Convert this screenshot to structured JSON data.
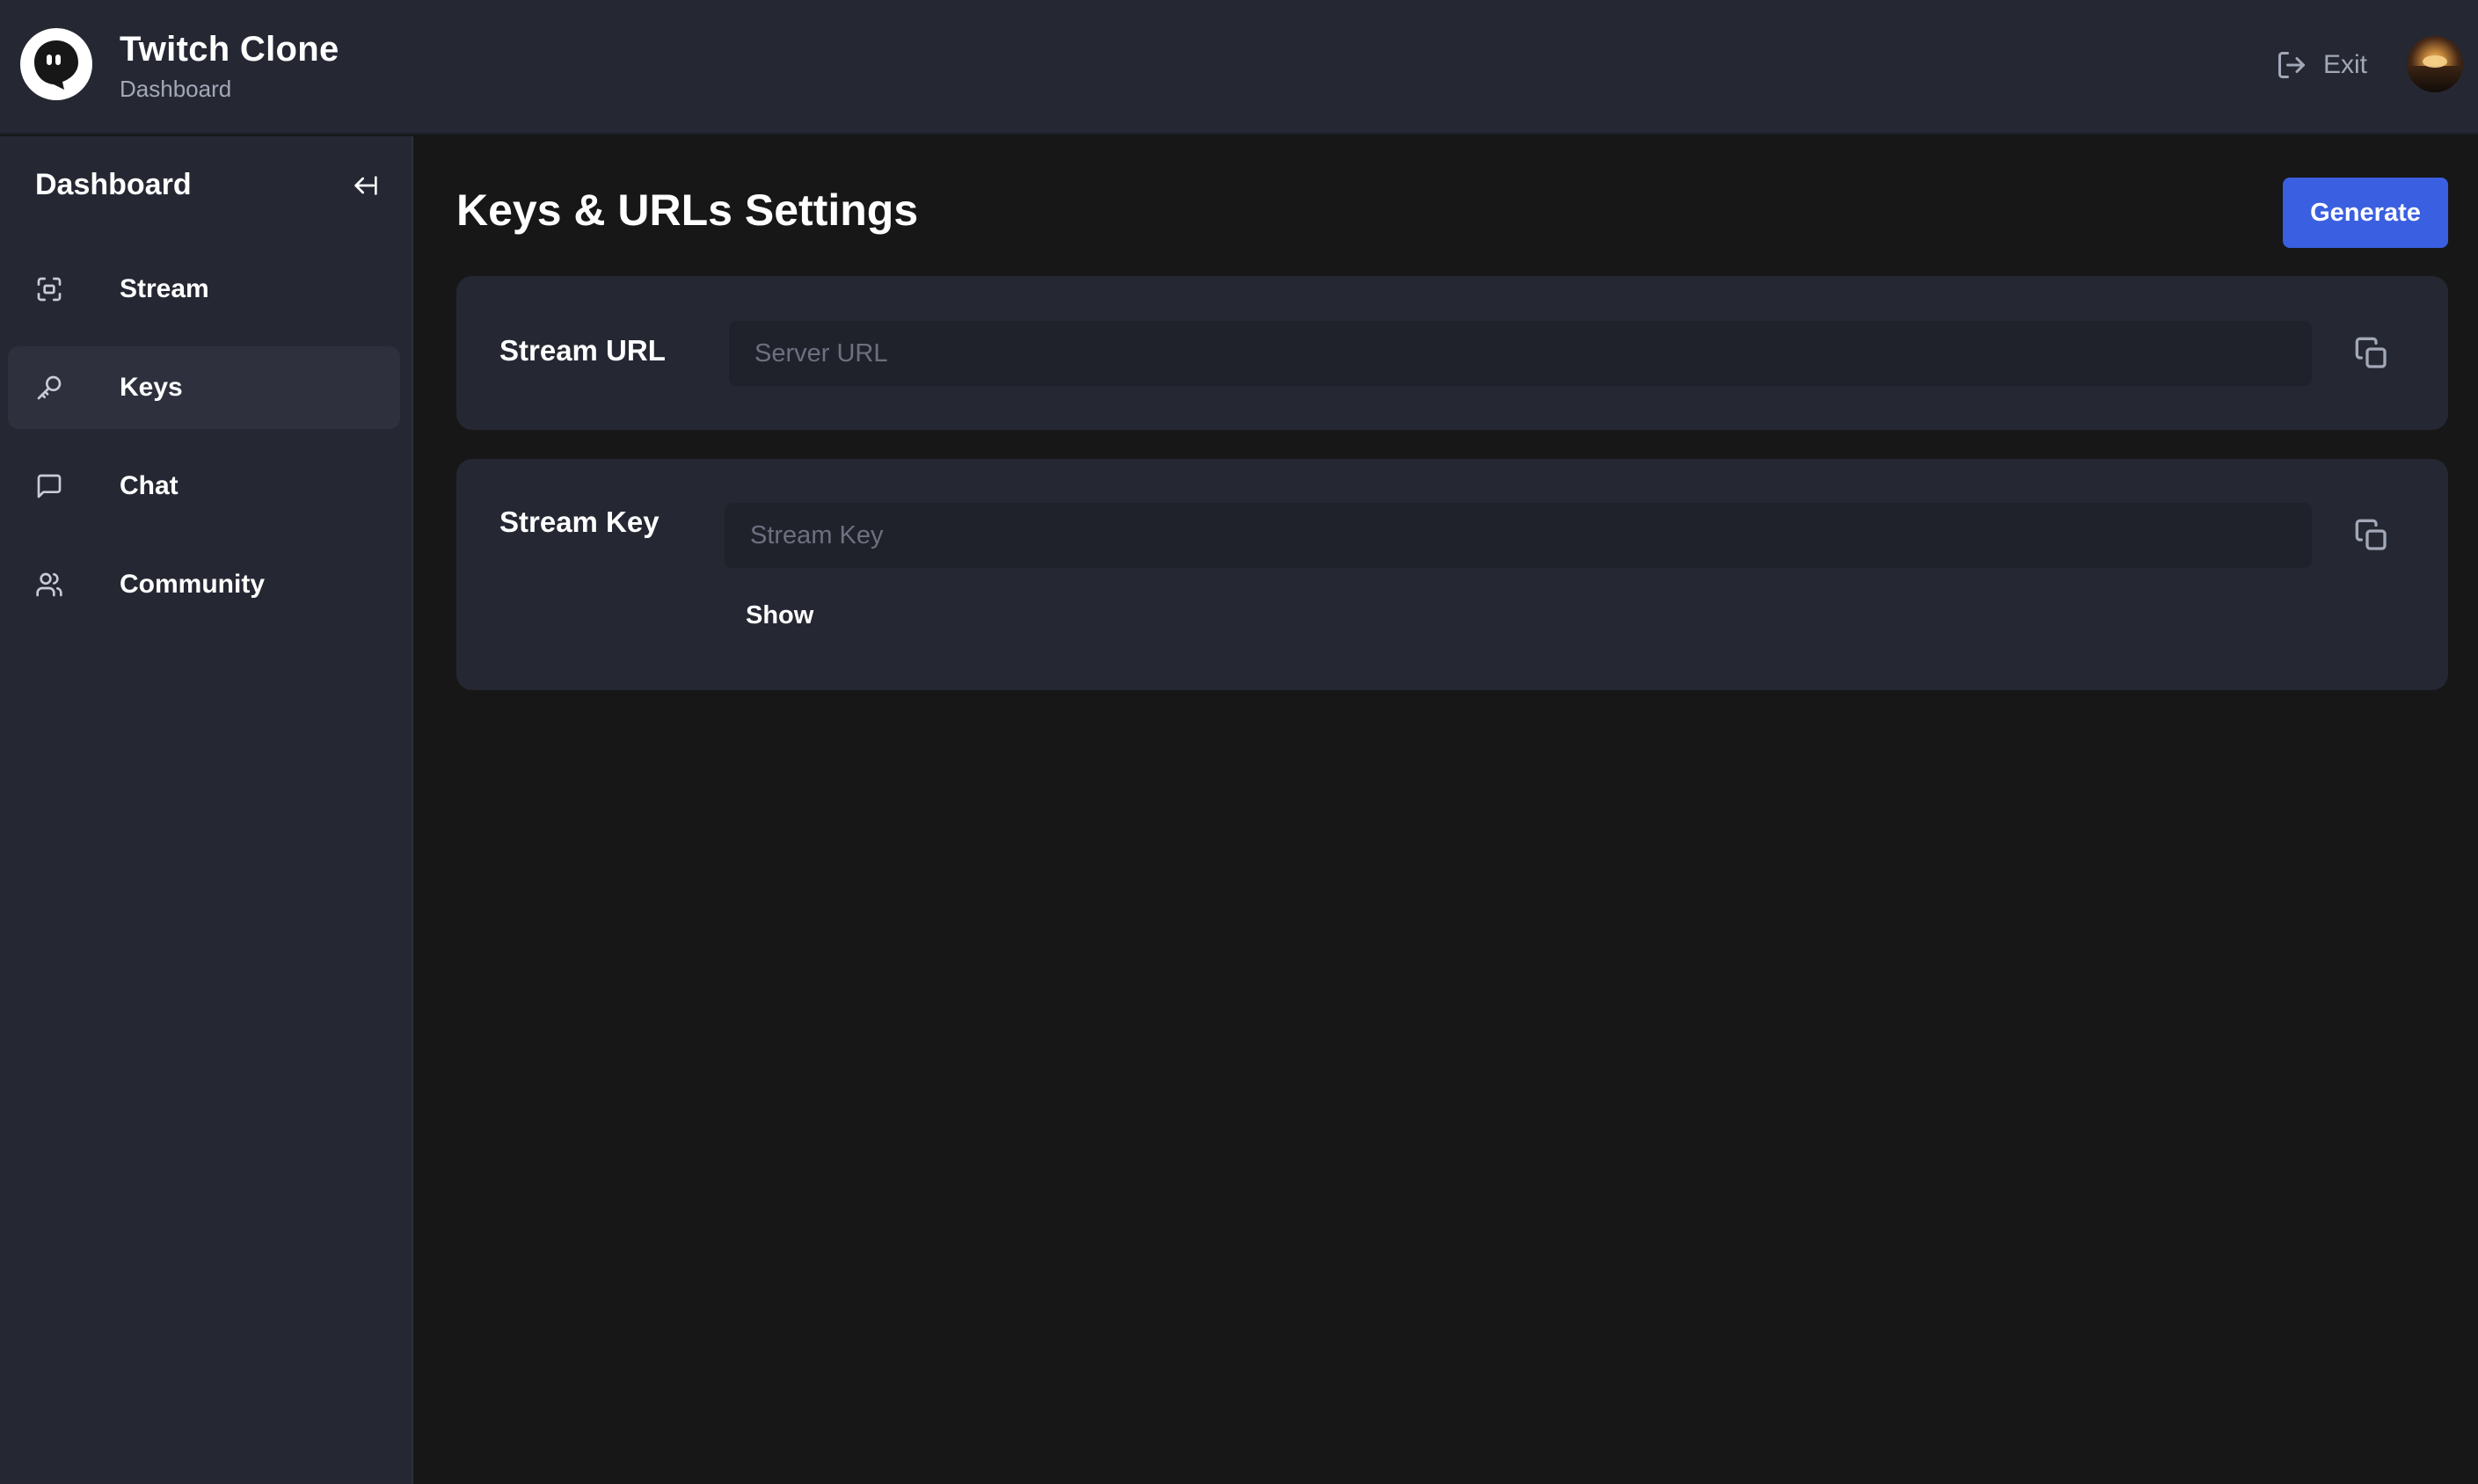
{
  "app": {
    "title": "Twitch Clone",
    "subtitle": "Dashboard"
  },
  "header": {
    "exit_label": "Exit",
    "exit_icon": "logout-icon",
    "avatar_icon": "user-avatar"
  },
  "sidebar": {
    "title": "Dashboard",
    "collapse_icon": "arrow-left-to-line-icon",
    "items": [
      {
        "label": "Stream",
        "icon": "fullscreen-icon",
        "active": false
      },
      {
        "label": "Keys",
        "icon": "key-icon",
        "active": true
      },
      {
        "label": "Chat",
        "icon": "message-square-icon",
        "active": false
      },
      {
        "label": "Community",
        "icon": "users-icon",
        "active": false
      }
    ]
  },
  "main": {
    "title": "Keys & URLs Settings",
    "generate_label": "Generate",
    "stream_url": {
      "label": "Stream URL",
      "value": "",
      "placeholder": "Server URL"
    },
    "stream_key": {
      "label": "Stream Key",
      "value": "",
      "placeholder": "Stream Key",
      "show_label": "Show"
    }
  },
  "colors": {
    "topbar": "#252833",
    "background": "#171718",
    "accent": "#3a5fe0",
    "muted_text": "#a3a8b8"
  }
}
